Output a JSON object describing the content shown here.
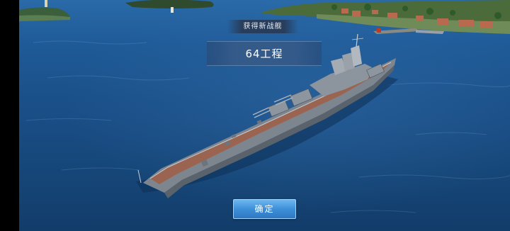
{
  "reward": {
    "banner_label": "获得新战舰",
    "ship_name": "64工程",
    "confirm_label": "确定"
  },
  "colors": {
    "water": "#1a4f88",
    "banner_bg": "#28374f",
    "name_panel_bg": "#375a87",
    "button": "#3d8fd8"
  }
}
